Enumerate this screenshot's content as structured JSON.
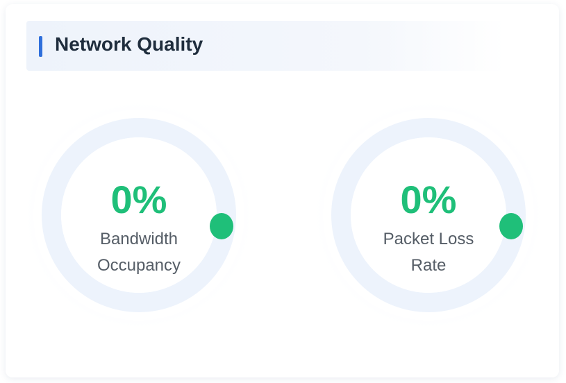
{
  "panel": {
    "title": "Network Quality"
  },
  "gauges": [
    {
      "value_text": "0%",
      "label_line1": "Bandwidth",
      "label_line2": "Occupancy",
      "value": 0
    },
    {
      "value_text": "0%",
      "label_line1": "Packet Loss",
      "label_line2": "Rate",
      "value": 0
    }
  ],
  "colors": {
    "accent": "#2f6fdb",
    "value_green": "#1fbf79",
    "ring_track": "#edf3fc"
  }
}
